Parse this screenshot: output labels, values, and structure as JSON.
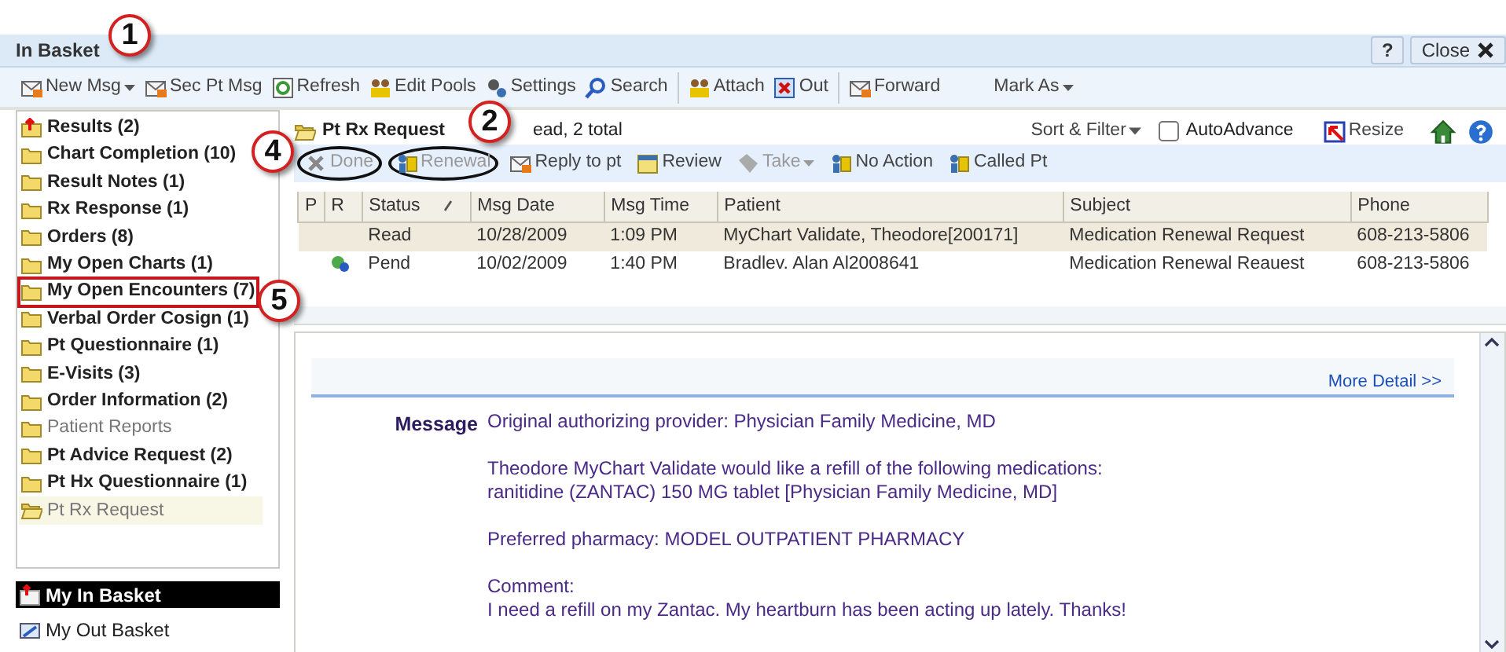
{
  "window": {
    "title": "In Basket",
    "help_button": "?",
    "close_button": "Close"
  },
  "toolbar": [
    {
      "kind": "button",
      "label": "New Msg",
      "dropdown": true
    },
    {
      "kind": "button",
      "label": "Sec Pt Msg",
      "dropdown": false
    },
    {
      "kind": "button",
      "label": "Refresh",
      "dropdown": false
    },
    {
      "kind": "button",
      "label": "Edit Pools",
      "dropdown": false
    },
    {
      "kind": "button",
      "label": "Settings",
      "dropdown": false
    },
    {
      "kind": "button",
      "label": "Search",
      "dropdown": false
    },
    {
      "kind": "separator"
    },
    {
      "kind": "button",
      "label": "Attach",
      "dropdown": false
    },
    {
      "kind": "button",
      "label": "Out",
      "dropdown": false
    },
    {
      "kind": "separator"
    },
    {
      "kind": "button",
      "label": "Forward",
      "dropdown": false
    },
    {
      "kind": "button",
      "label": "Mark As",
      "dropdown": true
    }
  ],
  "folders": [
    {
      "label": "Results (2)",
      "bold": true,
      "flagged": true,
      "selected": false,
      "boxed": false
    },
    {
      "label": "Chart Completion (10)",
      "bold": true,
      "flagged": false,
      "selected": false,
      "boxed": false
    },
    {
      "label": "Result Notes (1)",
      "bold": true,
      "flagged": false,
      "selected": false,
      "boxed": false
    },
    {
      "label": "Rx Response (1)",
      "bold": true,
      "flagged": false,
      "selected": false,
      "boxed": false
    },
    {
      "label": "Orders (8)",
      "bold": true,
      "flagged": false,
      "selected": false,
      "boxed": false
    },
    {
      "label": "My Open Charts (1)",
      "bold": true,
      "flagged": false,
      "selected": false,
      "boxed": false
    },
    {
      "label": "My Open Encounters (7)",
      "bold": true,
      "flagged": false,
      "selected": false,
      "boxed": true
    },
    {
      "label": "Verbal Order Cosign (1)",
      "bold": true,
      "flagged": false,
      "selected": false,
      "boxed": false
    },
    {
      "label": "Pt Questionnaire (1)",
      "bold": true,
      "flagged": false,
      "selected": false,
      "boxed": false
    },
    {
      "label": "E-Visits (3)",
      "bold": true,
      "flagged": false,
      "selected": false,
      "boxed": false
    },
    {
      "label": "Order Information (2)",
      "bold": true,
      "flagged": false,
      "selected": false,
      "boxed": false
    },
    {
      "label": "Patient Reports",
      "bold": false,
      "flagged": false,
      "selected": false,
      "boxed": false
    },
    {
      "label": "Pt Advice Request (2)",
      "bold": true,
      "flagged": false,
      "selected": false,
      "boxed": false
    },
    {
      "label": "Pt Hx Questionnaire (1)",
      "bold": true,
      "flagged": false,
      "selected": false,
      "boxed": false
    },
    {
      "label": "Pt Rx Request",
      "bold": false,
      "flagged": false,
      "selected": true,
      "boxed": false
    }
  ],
  "baskets": [
    {
      "label": "My In Basket",
      "selected": true
    },
    {
      "label": "My Out Basket",
      "selected": false
    }
  ],
  "folder_header": {
    "title": "Pt Rx Request",
    "summary": "ead, 2 total"
  },
  "view_options": {
    "sort_filter": "Sort & Filter",
    "auto_advance": {
      "label": "AutoAdvance",
      "checked": false
    },
    "resize": "Resize"
  },
  "actions": [
    {
      "label": "Done",
      "disabled": true,
      "dropdown": false,
      "circled": true
    },
    {
      "label": "Renewal",
      "disabled": true,
      "dropdown": false,
      "circled": true
    },
    {
      "label": "Reply to pt",
      "disabled": false,
      "dropdown": false,
      "circled": false
    },
    {
      "label": "Review",
      "disabled": false,
      "dropdown": false,
      "circled": false
    },
    {
      "label": "Take",
      "disabled": true,
      "dropdown": true,
      "circled": false
    },
    {
      "label": "No Action",
      "disabled": false,
      "dropdown": false,
      "circled": false
    },
    {
      "label": "Called Pt",
      "disabled": false,
      "dropdown": false,
      "circled": false
    }
  ],
  "table": {
    "columns": [
      {
        "label": "P",
        "sorted": false
      },
      {
        "label": "R",
        "sorted": false
      },
      {
        "label": "Status",
        "sorted": true
      },
      {
        "label": "Msg Date",
        "sorted": false
      },
      {
        "label": "Msg Time",
        "sorted": false
      },
      {
        "label": "Patient",
        "sorted": false
      },
      {
        "label": "Subject",
        "sorted": false
      },
      {
        "label": "Phone",
        "sorted": false
      }
    ],
    "rows": [
      {
        "selected": true,
        "pending_icon": false,
        "cells": [
          "",
          "",
          "Read",
          "10/28/2009",
          "1:09 PM",
          "MyChart Validate, Theodore[200171]",
          "Medication Renewal Request",
          "608-213-5806"
        ]
      },
      {
        "selected": false,
        "pending_icon": true,
        "cells": [
          "",
          "",
          "Pend",
          "10/02/2009",
          "1:40 PM",
          "Bradlev. Alan Al2008641",
          "Medication Renewal Reauest",
          "608-213-5806"
        ]
      }
    ]
  },
  "message": {
    "more_detail": "More Detail >>",
    "label": "Message",
    "paragraphs": [
      [
        "Original authorizing provider: Physician Family Medicine, MD"
      ],
      [
        "Theodore MyChart Validate would like a refill of the following medications:",
        "ranitidine (ZANTAC) 150 MG tablet [Physician Family Medicine, MD]"
      ],
      [
        "Preferred pharmacy: MODEL OUTPATIENT PHARMACY"
      ],
      [
        "Comment:",
        "I need a refill on my Zantac. My heartburn has been acting up lately. Thanks!"
      ]
    ]
  },
  "callouts": [
    {
      "label": "1"
    },
    {
      "label": "2"
    },
    {
      "label": "4"
    },
    {
      "label": "5"
    }
  ]
}
